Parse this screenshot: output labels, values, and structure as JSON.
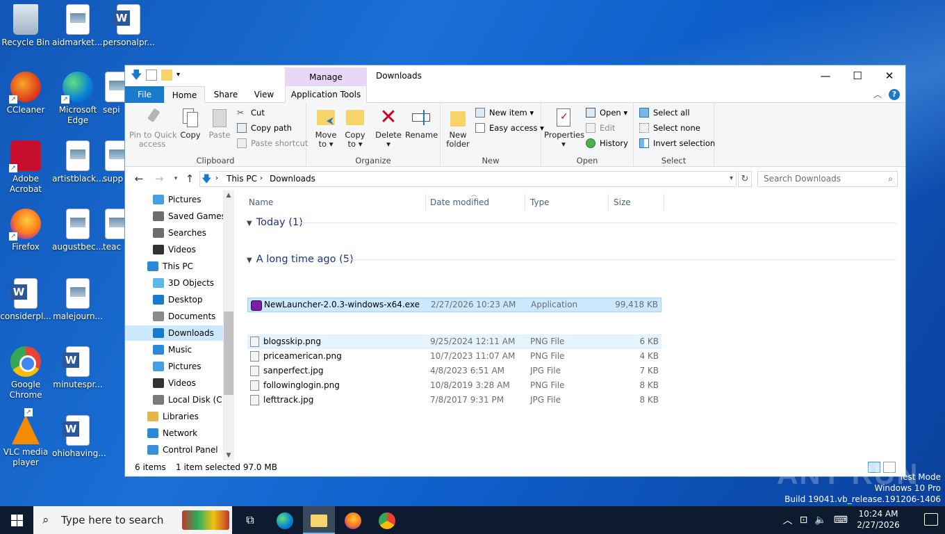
{
  "desktop": {
    "icons": [
      {
        "label": "Recycle Bin",
        "icon": "recycle-bin-icon"
      },
      {
        "label": "aidmarket....",
        "icon": "image-file-icon"
      },
      {
        "label": "personalpr...",
        "icon": "word-doc-icon"
      },
      {
        "label": "CCleaner",
        "icon": "ccleaner-icon"
      },
      {
        "label": "Microsoft\nEdge",
        "icon": "edge-icon"
      },
      {
        "label": "sepi",
        "icon": "image-file-icon"
      },
      {
        "label": "Adobe\nAcrobat",
        "icon": "acrobat-icon"
      },
      {
        "label": "artistblack....",
        "icon": "image-file-icon"
      },
      {
        "label": "supp",
        "icon": "image-file-icon"
      },
      {
        "label": "Firefox",
        "icon": "firefox-icon"
      },
      {
        "label": "augustbec...",
        "icon": "image-file-icon"
      },
      {
        "label": "teac",
        "icon": "image-file-icon"
      },
      {
        "label": "considerpl...",
        "icon": "word-doc-icon"
      },
      {
        "label": "malejourn...",
        "icon": "image-file-icon"
      },
      {
        "label": "Google\nChrome",
        "icon": "chrome-icon"
      },
      {
        "label": "minutespr...",
        "icon": "word-doc-icon"
      },
      {
        "label": "VLC media\nplayer",
        "icon": "vlc-icon"
      },
      {
        "label": "ohiohaving...",
        "icon": "word-doc-icon"
      }
    ]
  },
  "window": {
    "title": "Downloads",
    "contextual_tab": "Manage",
    "controls": {
      "minimize": "—",
      "maximize": "☐",
      "close": "✕"
    }
  },
  "ribbon_tabs": {
    "file": "File",
    "home": "Home",
    "share": "Share",
    "view": "View",
    "app_tools": "Application Tools"
  },
  "ribbon": {
    "clipboard": {
      "label": "Clipboard",
      "pin": "Pin to Quick\naccess",
      "copy": "Copy",
      "paste": "Paste",
      "cut": "Cut",
      "copy_path": "Copy path",
      "paste_shortcut": "Paste shortcut"
    },
    "organize": {
      "label": "Organize",
      "move_to": "Move\nto ▾",
      "copy_to": "Copy\nto ▾",
      "delete": "Delete\n▾",
      "rename": "Rename"
    },
    "new": {
      "label": "New",
      "new_folder": "New\nfolder",
      "new_item": "New item ▾",
      "easy_access": "Easy access ▾"
    },
    "open": {
      "label": "Open",
      "properties": "Properties\n▾",
      "open": "Open ▾",
      "edit": "Edit",
      "history": "History"
    },
    "select": {
      "label": "Select",
      "select_all": "Select all",
      "select_none": "Select none",
      "invert": "Invert selection"
    }
  },
  "address": {
    "crumbs": [
      "This PC",
      "Downloads"
    ],
    "search_placeholder": "Search Downloads"
  },
  "nav_pane": {
    "items": [
      {
        "label": "Pictures",
        "icon": "pictures-icon",
        "indent": 1
      },
      {
        "label": "Saved Games",
        "icon": "saved-games-icon",
        "indent": 1
      },
      {
        "label": "Searches",
        "icon": "searches-icon",
        "indent": 1
      },
      {
        "label": "Videos",
        "icon": "videos-icon",
        "indent": 1
      },
      {
        "label": "This PC",
        "icon": "this-pc-icon",
        "indent": 0
      },
      {
        "label": "3D Objects",
        "icon": "3d-objects-icon",
        "indent": 1
      },
      {
        "label": "Desktop",
        "icon": "desktop-icon",
        "indent": 1
      },
      {
        "label": "Documents",
        "icon": "documents-icon",
        "indent": 1
      },
      {
        "label": "Downloads",
        "icon": "downloads-icon",
        "indent": 1,
        "selected": true
      },
      {
        "label": "Music",
        "icon": "music-icon",
        "indent": 1
      },
      {
        "label": "Pictures",
        "icon": "pictures-icon",
        "indent": 1
      },
      {
        "label": "Videos",
        "icon": "videos-icon",
        "indent": 1
      },
      {
        "label": "Local Disk (C:)",
        "icon": "local-disk-icon",
        "indent": 1
      },
      {
        "label": "Libraries",
        "icon": "libraries-icon",
        "indent": 0
      },
      {
        "label": "Network",
        "icon": "network-icon",
        "indent": 0
      },
      {
        "label": "Control Panel",
        "icon": "control-panel-icon",
        "indent": 0
      }
    ]
  },
  "columns": {
    "name": "Name",
    "date": "Date modified",
    "type": "Type",
    "size": "Size"
  },
  "groups": {
    "today": {
      "label": "Today (1)",
      "files": [
        {
          "name": "NewLauncher-2.0.3-windows-x64.exe",
          "date": "2/27/2026 10:23 AM",
          "type": "Application",
          "size": "99,418 KB"
        }
      ]
    },
    "long_ago": {
      "label": "A long time ago (5)",
      "files": [
        {
          "name": "blogsskip.png",
          "date": "9/25/2024 12:11 AM",
          "type": "PNG File",
          "size": "6 KB"
        },
        {
          "name": "priceamerican.png",
          "date": "10/7/2023 11:07 AM",
          "type": "PNG File",
          "size": "4 KB"
        },
        {
          "name": "sanperfect.jpg",
          "date": "4/8/2023 6:51 AM",
          "type": "JPG File",
          "size": "7 KB"
        },
        {
          "name": "followinglogin.png",
          "date": "10/8/2019 3:28 AM",
          "type": "PNG File",
          "size": "8 KB"
        },
        {
          "name": "lefttrack.jpg",
          "date": "7/8/2017 9:31 PM",
          "type": "JPG File",
          "size": "8 KB"
        }
      ]
    }
  },
  "status": {
    "count": "6 items",
    "selected": "1 item selected  97.0 MB"
  },
  "watermark": {
    "brand": "ANY RUN",
    "mode": "Test Mode",
    "edition": "Windows 10 Pro",
    "build": "Build 19041.vb_release.191206-1406"
  },
  "taskbar": {
    "search_placeholder": "Type here to search",
    "time": "10:24 AM",
    "date": "2/27/2026"
  }
}
